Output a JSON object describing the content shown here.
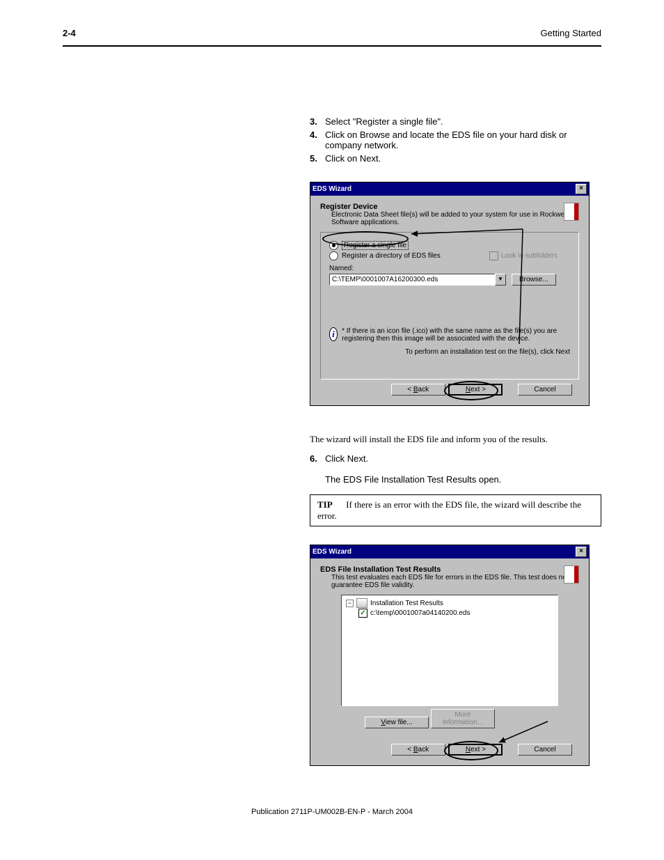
{
  "header": {
    "left": "2-4",
    "right": "Getting Started"
  },
  "steps_top": [
    {
      "n": "3.",
      "t": "Select \"Register a single file\"."
    },
    {
      "n": "4.",
      "t": "Click on Browse and locate the EDS file on your hard disk or company network."
    },
    {
      "n": "5.",
      "t": "Click on Next."
    }
  ],
  "dlg1": {
    "title": "EDS Wizard",
    "heading": "Register Device",
    "sub": "Electronic Data Sheet file(s) will be added to your system for use in Rockwell Software applications.",
    "radio_single": "Register a single file",
    "radio_dir": "Register a directory of EDS files",
    "chk_label": "Look in subfolders",
    "named": "Named:",
    "path": "C:\\TEMP\\0001007A16200300.eds",
    "browse": "Browse...",
    "info_text": "* If there is an icon file (.ico) with the same name as the file(s) you are registering then this image will be associated with the device.",
    "note": "To perform an installation test on the file(s), click Next",
    "back": "Back",
    "next": "Next >",
    "cancel": "Cancel"
  },
  "mid_result": "The wizard will install the EDS file and inform you of the results.",
  "mid_step": {
    "n": "6.",
    "one": "Click Next.",
    "two": "The EDS File Installation Test Results open."
  },
  "tip": {
    "label": "TIP",
    "body": "If there is an error with the EDS file, the wizard will describe the error."
  },
  "dlg2": {
    "title": "EDS Wizard",
    "heading": "EDS File Installation Test Results",
    "sub": "This test evaluates each EDS file for errors in the EDS file. This test does not guarantee EDS file validity.",
    "tree_root": "Installation Test Results",
    "tree_item": "c:\\temp\\0001007a04140200.eds",
    "view": "View file...",
    "more": "More Information...",
    "back": "Back",
    "next": "Next >",
    "cancel": "Cancel"
  },
  "footer": "Publication 2711P-UM002B-EN-P - March 2004"
}
